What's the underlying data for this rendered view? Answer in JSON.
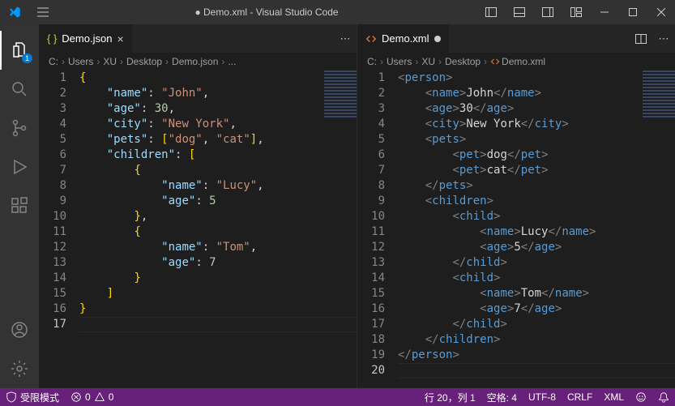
{
  "titlebar": {
    "title": "● Demo.xml - Visual Studio Code"
  },
  "activity": {
    "explorer_badge": "1"
  },
  "left": {
    "tab_label": "Demo.json",
    "breadcrumb": [
      "C:",
      "Users",
      "XU",
      "Desktop",
      "Demo.json",
      "..."
    ],
    "lines": [
      {
        "n": "1",
        "t": [
          [
            "br",
            "{"
          ]
        ]
      },
      {
        "n": "2",
        "t": [
          [
            "pun",
            "    "
          ],
          [
            "key",
            "\"name\""
          ],
          [
            "pun",
            ": "
          ],
          [
            "str",
            "\"John\""
          ],
          [
            "pun",
            ","
          ]
        ]
      },
      {
        "n": "3",
        "t": [
          [
            "pun",
            "    "
          ],
          [
            "key",
            "\"age\""
          ],
          [
            "pun",
            ": "
          ],
          [
            "num",
            "30"
          ],
          [
            "pun",
            ","
          ]
        ]
      },
      {
        "n": "4",
        "t": [
          [
            "pun",
            "    "
          ],
          [
            "key",
            "\"city\""
          ],
          [
            "pun",
            ": "
          ],
          [
            "str",
            "\"New York\""
          ],
          [
            "pun",
            ","
          ]
        ]
      },
      {
        "n": "5",
        "t": [
          [
            "pun",
            "    "
          ],
          [
            "key",
            "\"pets\""
          ],
          [
            "pun",
            ": "
          ],
          [
            "br",
            "["
          ],
          [
            "str",
            "\"dog\""
          ],
          [
            "pun",
            ", "
          ],
          [
            "str",
            "\"cat\""
          ],
          [
            "br",
            "]"
          ],
          [
            "pun",
            ","
          ]
        ]
      },
      {
        "n": "6",
        "t": [
          [
            "pun",
            "    "
          ],
          [
            "key",
            "\"children\""
          ],
          [
            "pun",
            ": "
          ],
          [
            "br",
            "["
          ]
        ]
      },
      {
        "n": "7",
        "t": [
          [
            "pun",
            "        "
          ],
          [
            "br",
            "{"
          ]
        ]
      },
      {
        "n": "8",
        "t": [
          [
            "pun",
            "            "
          ],
          [
            "key",
            "\"name\""
          ],
          [
            "pun",
            ": "
          ],
          [
            "str",
            "\"Lucy\""
          ],
          [
            "pun",
            ","
          ]
        ]
      },
      {
        "n": "9",
        "t": [
          [
            "pun",
            "            "
          ],
          [
            "key",
            "\"age\""
          ],
          [
            "pun",
            ": "
          ],
          [
            "num",
            "5"
          ]
        ]
      },
      {
        "n": "10",
        "t": [
          [
            "pun",
            "        "
          ],
          [
            "br",
            "}"
          ],
          [
            "pun",
            ","
          ]
        ]
      },
      {
        "n": "11",
        "t": [
          [
            "pun",
            "        "
          ],
          [
            "br",
            "{"
          ]
        ]
      },
      {
        "n": "12",
        "t": [
          [
            "pun",
            "            "
          ],
          [
            "key",
            "\"name\""
          ],
          [
            "pun",
            ": "
          ],
          [
            "str",
            "\"Tom\""
          ],
          [
            "pun",
            ","
          ]
        ]
      },
      {
        "n": "13",
        "t": [
          [
            "pun",
            "            "
          ],
          [
            "key",
            "\"age\""
          ],
          [
            "pun",
            ": "
          ],
          [
            "num",
            "7"
          ]
        ]
      },
      {
        "n": "14",
        "t": [
          [
            "pun",
            "        "
          ],
          [
            "br",
            "}"
          ]
        ]
      },
      {
        "n": "15",
        "t": [
          [
            "pun",
            "    "
          ],
          [
            "br",
            "]"
          ]
        ]
      },
      {
        "n": "16",
        "t": [
          [
            "br",
            "}"
          ]
        ]
      },
      {
        "n": "17",
        "t": []
      }
    ],
    "cursor_line": 17
  },
  "right": {
    "tab_label": "Demo.xml",
    "breadcrumb": [
      "C:",
      "Users",
      "XU",
      "Desktop",
      "Demo.xml"
    ],
    "lines": [
      {
        "n": "1",
        "t": [
          [
            "ang",
            "<"
          ],
          [
            "tag",
            "person"
          ],
          [
            "ang",
            ">"
          ]
        ]
      },
      {
        "n": "2",
        "t": [
          [
            "pun",
            "    "
          ],
          [
            "ang",
            "<"
          ],
          [
            "tag",
            "name"
          ],
          [
            "ang",
            ">"
          ],
          [
            "txt",
            "John"
          ],
          [
            "ang",
            "</"
          ],
          [
            "tag",
            "name"
          ],
          [
            "ang",
            ">"
          ]
        ]
      },
      {
        "n": "3",
        "t": [
          [
            "pun",
            "    "
          ],
          [
            "ang",
            "<"
          ],
          [
            "tag",
            "age"
          ],
          [
            "ang",
            ">"
          ],
          [
            "txt",
            "30"
          ],
          [
            "ang",
            "</"
          ],
          [
            "tag",
            "age"
          ],
          [
            "ang",
            ">"
          ]
        ]
      },
      {
        "n": "4",
        "t": [
          [
            "pun",
            "    "
          ],
          [
            "ang",
            "<"
          ],
          [
            "tag",
            "city"
          ],
          [
            "ang",
            ">"
          ],
          [
            "txt",
            "New York"
          ],
          [
            "ang",
            "</"
          ],
          [
            "tag",
            "city"
          ],
          [
            "ang",
            ">"
          ]
        ]
      },
      {
        "n": "5",
        "t": [
          [
            "pun",
            "    "
          ],
          [
            "ang",
            "<"
          ],
          [
            "tag",
            "pets"
          ],
          [
            "ang",
            ">"
          ]
        ]
      },
      {
        "n": "6",
        "t": [
          [
            "pun",
            "        "
          ],
          [
            "ang",
            "<"
          ],
          [
            "tag",
            "pet"
          ],
          [
            "ang",
            ">"
          ],
          [
            "txt",
            "dog"
          ],
          [
            "ang",
            "</"
          ],
          [
            "tag",
            "pet"
          ],
          [
            "ang",
            ">"
          ]
        ]
      },
      {
        "n": "7",
        "t": [
          [
            "pun",
            "        "
          ],
          [
            "ang",
            "<"
          ],
          [
            "tag",
            "pet"
          ],
          [
            "ang",
            ">"
          ],
          [
            "txt",
            "cat"
          ],
          [
            "ang",
            "</"
          ],
          [
            "tag",
            "pet"
          ],
          [
            "ang",
            ">"
          ]
        ]
      },
      {
        "n": "8",
        "t": [
          [
            "pun",
            "    "
          ],
          [
            "ang",
            "</"
          ],
          [
            "tag",
            "pets"
          ],
          [
            "ang",
            ">"
          ]
        ]
      },
      {
        "n": "9",
        "t": [
          [
            "pun",
            "    "
          ],
          [
            "ang",
            "<"
          ],
          [
            "tag",
            "children"
          ],
          [
            "ang",
            ">"
          ]
        ]
      },
      {
        "n": "10",
        "t": [
          [
            "pun",
            "        "
          ],
          [
            "ang",
            "<"
          ],
          [
            "tag",
            "child"
          ],
          [
            "ang",
            ">"
          ]
        ]
      },
      {
        "n": "11",
        "t": [
          [
            "pun",
            "            "
          ],
          [
            "ang",
            "<"
          ],
          [
            "tag",
            "name"
          ],
          [
            "ang",
            ">"
          ],
          [
            "txt",
            "Lucy"
          ],
          [
            "ang",
            "</"
          ],
          [
            "tag",
            "name"
          ],
          [
            "ang",
            ">"
          ]
        ]
      },
      {
        "n": "12",
        "t": [
          [
            "pun",
            "            "
          ],
          [
            "ang",
            "<"
          ],
          [
            "tag",
            "age"
          ],
          [
            "ang",
            ">"
          ],
          [
            "txt",
            "5"
          ],
          [
            "ang",
            "</"
          ],
          [
            "tag",
            "age"
          ],
          [
            "ang",
            ">"
          ]
        ]
      },
      {
        "n": "13",
        "t": [
          [
            "pun",
            "        "
          ],
          [
            "ang",
            "</"
          ],
          [
            "tag",
            "child"
          ],
          [
            "ang",
            ">"
          ]
        ]
      },
      {
        "n": "14",
        "t": [
          [
            "pun",
            "        "
          ],
          [
            "ang",
            "<"
          ],
          [
            "tag",
            "child"
          ],
          [
            "ang",
            ">"
          ]
        ]
      },
      {
        "n": "15",
        "t": [
          [
            "pun",
            "            "
          ],
          [
            "ang",
            "<"
          ],
          [
            "tag",
            "name"
          ],
          [
            "ang",
            ">"
          ],
          [
            "txt",
            "Tom"
          ],
          [
            "ang",
            "</"
          ],
          [
            "tag",
            "name"
          ],
          [
            "ang",
            ">"
          ]
        ]
      },
      {
        "n": "16",
        "t": [
          [
            "pun",
            "            "
          ],
          [
            "ang",
            "<"
          ],
          [
            "tag",
            "age"
          ],
          [
            "ang",
            ">"
          ],
          [
            "txt",
            "7"
          ],
          [
            "ang",
            "</"
          ],
          [
            "tag",
            "age"
          ],
          [
            "ang",
            ">"
          ]
        ]
      },
      {
        "n": "17",
        "t": [
          [
            "pun",
            "        "
          ],
          [
            "ang",
            "</"
          ],
          [
            "tag",
            "child"
          ],
          [
            "ang",
            ">"
          ]
        ]
      },
      {
        "n": "18",
        "t": [
          [
            "pun",
            "    "
          ],
          [
            "ang",
            "</"
          ],
          [
            "tag",
            "children"
          ],
          [
            "ang",
            ">"
          ]
        ]
      },
      {
        "n": "19",
        "t": [
          [
            "ang",
            "</"
          ],
          [
            "tag",
            "person"
          ],
          [
            "ang",
            ">"
          ]
        ]
      },
      {
        "n": "20",
        "t": []
      }
    ],
    "cursor_line": 20
  },
  "status": {
    "restricted": "受限模式",
    "errors": "0",
    "warnings": "0",
    "line_col": "行 20，列 1",
    "spaces": "空格: 4",
    "encoding": "UTF-8",
    "eol": "CRLF",
    "lang": "XML",
    "feedback": ""
  }
}
